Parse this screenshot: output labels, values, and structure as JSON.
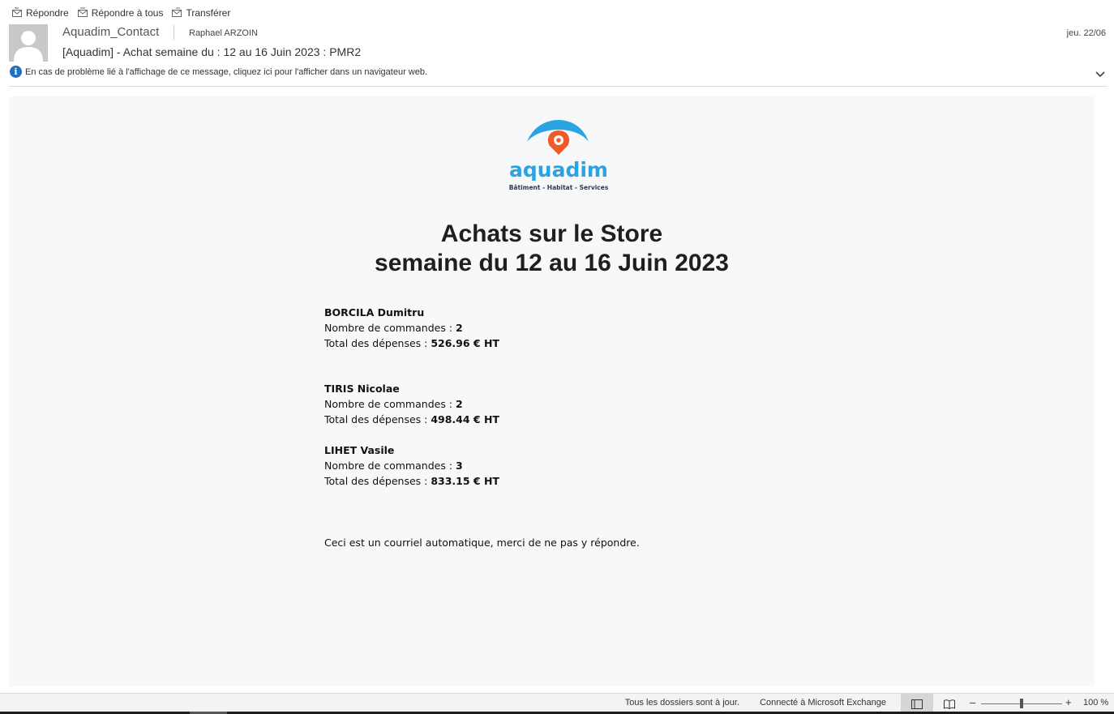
{
  "toolbar": {
    "reply": "Répondre",
    "reply_all": "Répondre à tous",
    "forward": "Transférer"
  },
  "message": {
    "from": "Aquadim_Contact",
    "to": "Raphael ARZOIN",
    "date": "jeu. 22/06",
    "subject": "[Aquadim] - Achat semaine du : 12 au 16 Juin 2023 : PMR2",
    "info_bar": "En cas de problème lié à l'affichage de ce message, cliquez ici pour l'afficher dans un navigateur web."
  },
  "body": {
    "logo_text": "aquadim",
    "logo_tagline": "Bâtiment - Habitat - Services",
    "title_line1": "Achats sur le Store",
    "title_line2": "semaine du 12 au 16 Juin 2023",
    "orders_label": "Nombre de commandes : ",
    "total_label": "Total des dépenses : ",
    "people": [
      {
        "name": "BORCILA Dumitru",
        "orders": "2",
        "total": "526.96 € HT"
      },
      {
        "name": "TIRIS Nicolae",
        "orders": "2",
        "total": "498.44 € HT"
      },
      {
        "name": "LIHET Vasile",
        "orders": "3",
        "total": "833.15 € HT"
      }
    ],
    "footer": "Ceci est un courriel automatique, merci de ne pas y répondre."
  },
  "statusbar": {
    "folders_status": "Tous les dossiers sont à jour.",
    "connection": "Connecté à Microsoft Exchange",
    "zoom_minus": "–",
    "zoom_plus": "+",
    "zoom": "100 %"
  },
  "colors": {
    "logo_blue": "#2ba3e0",
    "logo_orange": "#ef5a27",
    "info_blue": "#1f6fc2"
  }
}
